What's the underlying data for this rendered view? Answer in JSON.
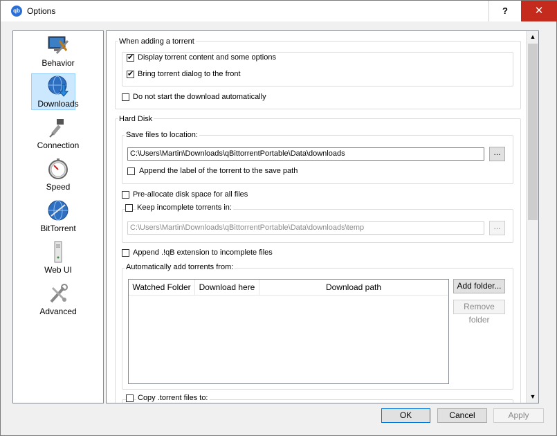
{
  "window": {
    "title": "Options",
    "help_label": "?",
    "close_label": "✕",
    "app_icon_text": "qb"
  },
  "sidebar": {
    "items": [
      {
        "label": "Behavior",
        "icon": "monitor-tools-icon",
        "selected": false
      },
      {
        "label": "Downloads",
        "icon": "globe-download-icon",
        "selected": true
      },
      {
        "label": "Connection",
        "icon": "plug-icon",
        "selected": false
      },
      {
        "label": "Speed",
        "icon": "stopwatch-icon",
        "selected": false
      },
      {
        "label": "BitTorrent",
        "icon": "globe-icon",
        "selected": false
      },
      {
        "label": "Web UI",
        "icon": "tower-icon",
        "selected": false
      },
      {
        "label": "Advanced",
        "icon": "tools-icon",
        "selected": false
      }
    ]
  },
  "adding": {
    "group_label": "When adding a torrent",
    "display_content_label": "Display torrent content and some options",
    "bring_front_label": "Bring torrent dialog to the front",
    "no_start_label": "Do not start the download automatically"
  },
  "hdd": {
    "group_label": "Hard Disk",
    "save_group_label": "Save files to location:",
    "save_path": "C:\\Users\\Martin\\Downloads\\qBittorrentPortable\\Data\\downloads",
    "browse_label": "...",
    "append_label_label": "Append the label of the torrent to the save path",
    "preallocate_label": "Pre-allocate disk space for all files",
    "keep_incomplete_label": "Keep incomplete torrents in:",
    "temp_path": "C:\\Users\\Martin\\Downloads\\qBittorrentPortable\\Data\\downloads\\temp",
    "append_qb_label": "Append .!qB extension to incomplete files",
    "auto_add_label": "Automatically add torrents from:",
    "columns": [
      "Watched Folder",
      "Download here",
      "Download path"
    ],
    "add_folder_label": "Add folder...",
    "remove_folder_label": "Remove folder",
    "copy_torrent_label": "Copy .torrent files to:"
  },
  "footer": {
    "ok_label": "OK",
    "cancel_label": "Cancel",
    "apply_label": "Apply"
  }
}
